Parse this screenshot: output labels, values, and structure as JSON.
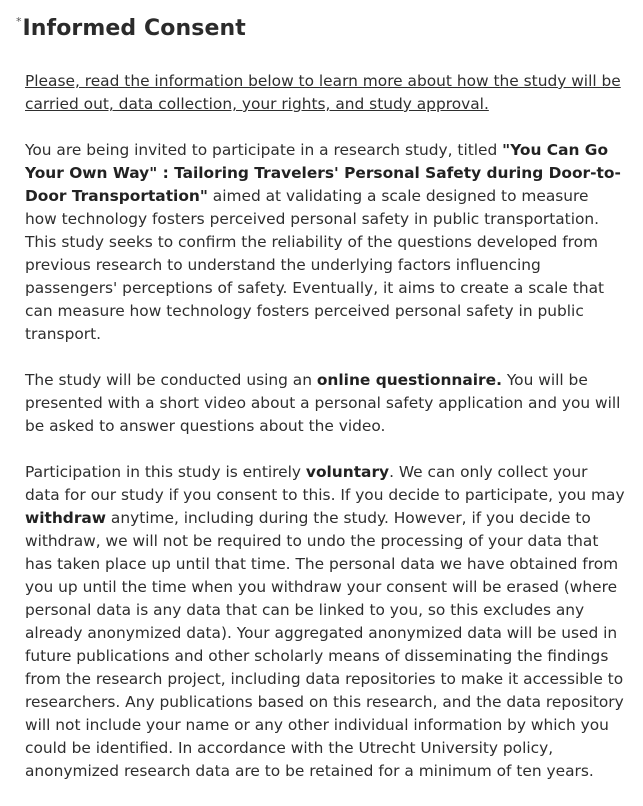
{
  "question": {
    "required_marker": "*",
    "title": "Informed Consent"
  },
  "intro": {
    "link_text": "Please, read the information below to learn more about how the study will be carried out, data collection, your rights, and study approval."
  },
  "paragraph1": {
    "t1": "You are being invited to participate in a research study, titled ",
    "study_title": "\"You Can Go Your Own Way\" : Tailoring Travelers' Personal Safety during Door-to-Door Transportation\"",
    "t2": " aimed at validating a scale designed to measure how technology fosters perceived personal safety in public transportation. This study seeks to confirm the reliability of the questions developed from previous research to understand the underlying factors influencing passengers' perceptions of safety. Eventually, it aims to create a scale that can measure how technology fosters perceived personal safety in public transport."
  },
  "paragraph2": {
    "t1": "The study will be conducted using an ",
    "method": "online questionnaire.",
    "t2": " You will be presented with a short video about a personal safety application and you will be asked to answer questions about the video."
  },
  "paragraph3": {
    "t1": "Participation in this study is entirely ",
    "voluntary": "voluntary",
    "t2": ". We can only collect your data for our study if you consent to this. If you decide to participate, you may ",
    "withdraw": "withdraw",
    "t3": " anytime, including during the study. However, if you decide to withdraw, we will not be required to undo the processing of your data that has taken place up until that time. The personal data we have obtained from you up until the time when you withdraw your consent will be erased (where personal data is any data that can be linked to you, so this excludes any already anonymized data). Your aggregated anonymized data will be used in future publications and other scholarly means of disseminating the findings from the research project, including data repositories to make it accessible to researchers. Any publications based on this research, and the data repository will not include your name or any other individual information by which you could be identified. In accordance with the Utrecht University policy, anonymized research data are to be retained for a minimum of ten years."
  }
}
